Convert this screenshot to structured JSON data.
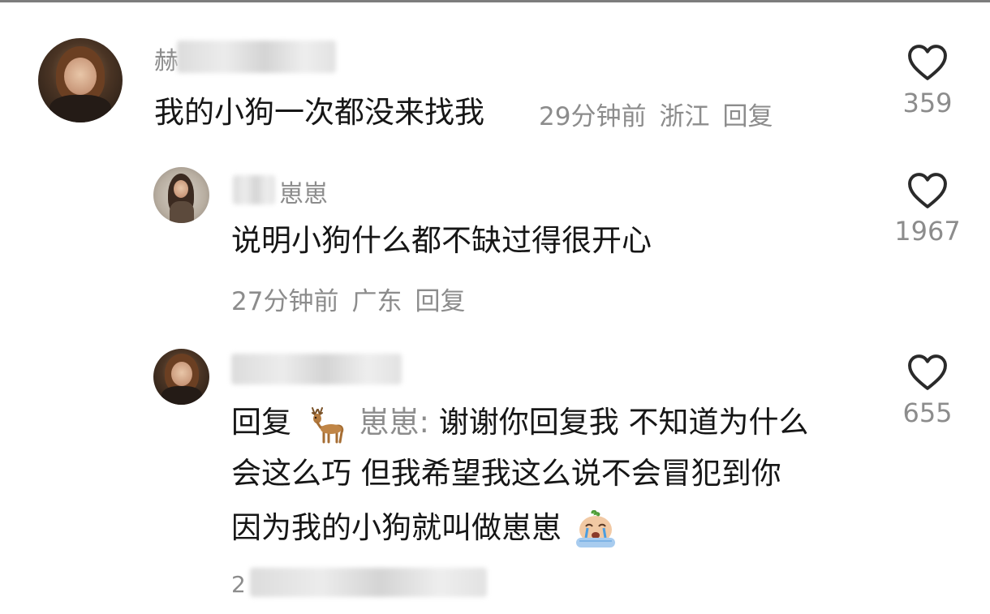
{
  "comments": [
    {
      "username_partial": "赫",
      "text": "我的小狗一次都没来找我",
      "time": "29分钟前",
      "location": "浙江",
      "reply_label": "回复",
      "likes": "359"
    },
    {
      "username_partial": "崽崽",
      "text": "说明小狗什么都不缺过得很开心",
      "time": "27分钟前",
      "location": "广东",
      "reply_label": "回复",
      "likes": "1967"
    },
    {
      "reply_prefix": "回复",
      "reply_to_user": "崽崽:",
      "text_line1": "谢谢你回复我 不知道为什么",
      "text_line2": "会这么巧 但我希望我这么说不会冒犯到你",
      "text_line3": "因为我的小狗就叫做崽崽",
      "likes": "655",
      "sub_count": "2"
    }
  ],
  "icons": {
    "heart": "heart-outline-icon",
    "deer": "deer-emoji-icon",
    "crying": "crying-emoji-icon"
  },
  "colors": {
    "text": "#161616",
    "secondary": "#8c8c8c"
  }
}
